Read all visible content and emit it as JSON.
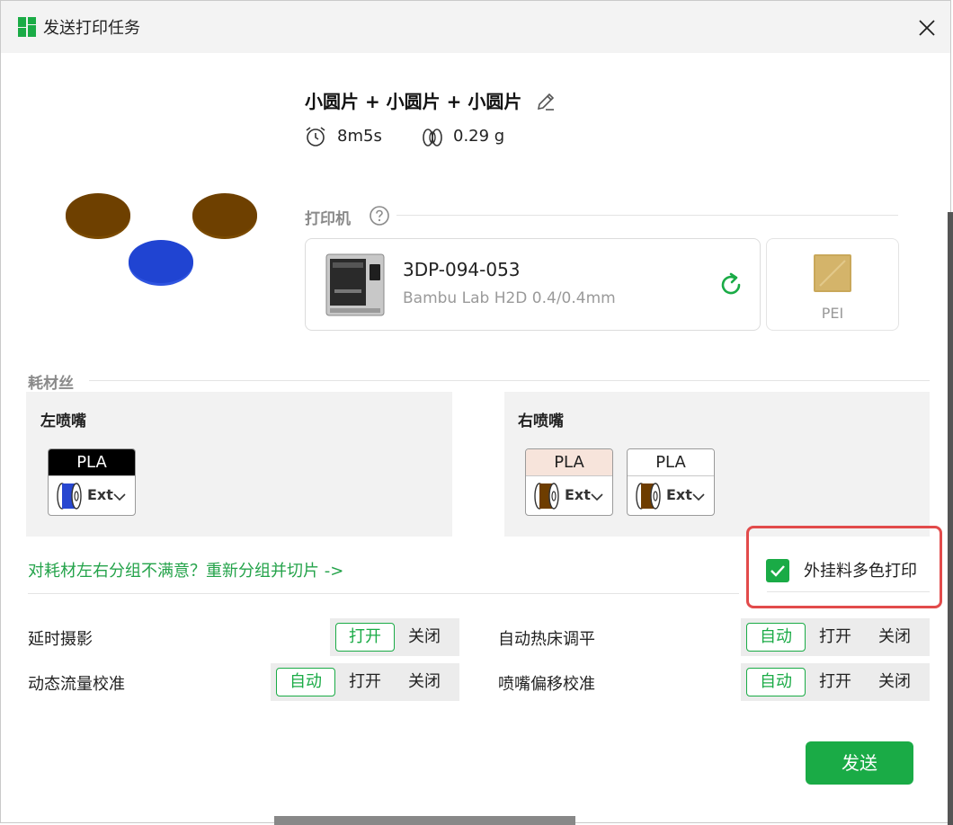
{
  "window": {
    "title": "发送打印任务"
  },
  "job": {
    "name": "小圆片 + 小圆片 + 小圆片",
    "time": "8m5s",
    "weight": "0.29 g"
  },
  "printer_section": {
    "label": "打印机",
    "printer": {
      "name": "3DP-094-053",
      "model": "Bambu Lab H2D  0.4/0.4mm"
    },
    "plate": {
      "label": "PEI"
    }
  },
  "filament_section": {
    "label": "耗材丝",
    "left": {
      "title": "左喷嘴",
      "slots": [
        {
          "type": "PLA",
          "ext": "Ext",
          "header_bg": "#000000",
          "header_fg": "#ffffff",
          "spool_color": "#2847d0"
        }
      ]
    },
    "right": {
      "title": "右喷嘴",
      "slots": [
        {
          "type": "PLA",
          "ext": "Ext",
          "header_bg": "#f7e4db",
          "header_fg": "#222222",
          "spool_color": "#6e3d00"
        },
        {
          "type": "PLA",
          "ext": "Ext",
          "header_bg": "#ffffff",
          "header_fg": "#222222",
          "spool_color": "#6e3d00"
        }
      ]
    },
    "regroup_link": "对耗材左右分组不满意？重新分组并切片 ->",
    "external_multicolor": {
      "label": "外挂料多色打印",
      "checked": true
    }
  },
  "options": {
    "timelapse": {
      "label": "延时摄影",
      "choices": [
        "打开",
        "关闭"
      ],
      "selected": "打开"
    },
    "flow_calibration": {
      "label": "动态流量校准",
      "choices": [
        "自动",
        "打开",
        "关闭"
      ],
      "selected": "自动"
    },
    "bed_leveling": {
      "label": "自动热床调平",
      "choices": [
        "自动",
        "打开",
        "关闭"
      ],
      "selected": "自动"
    },
    "nozzle_offset": {
      "label": "喷嘴偏移校准",
      "choices": [
        "自动",
        "打开",
        "关闭"
      ],
      "selected": "自动"
    }
  },
  "actions": {
    "send": "发送"
  },
  "colors": {
    "accent": "#1aab46",
    "highlight": "#e24b4b",
    "model_brown": "#6e4000",
    "model_blue": "#2044d2"
  }
}
